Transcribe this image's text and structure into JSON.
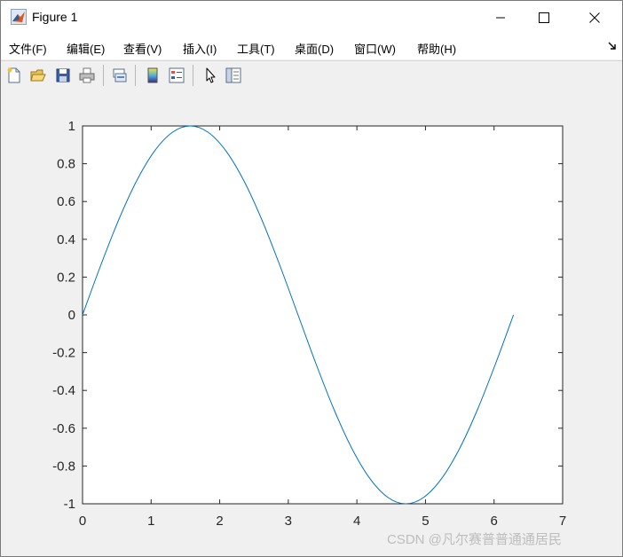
{
  "window": {
    "title": "Figure 1",
    "icon": "matlab-logo-icon"
  },
  "menu": {
    "items": [
      {
        "label": "文件(F)"
      },
      {
        "label": "编辑(E)"
      },
      {
        "label": "查看(V)"
      },
      {
        "label": "插入(I)"
      },
      {
        "label": "工具(T)"
      },
      {
        "label": "桌面(D)"
      },
      {
        "label": "窗口(W)"
      },
      {
        "label": "帮助(H)"
      }
    ]
  },
  "toolbar": {
    "buttons": [
      "new-figure-icon",
      "open-file-icon",
      "save-icon",
      "print-icon",
      "link-plot-icon",
      "insert-colorbar-icon",
      "insert-legend-icon",
      "edit-plot-arrow-icon",
      "property-inspector-icon"
    ]
  },
  "watermark": "CSDN @凡尔赛普普通通居民",
  "chart_data": {
    "type": "line",
    "title": "",
    "xlabel": "",
    "ylabel": "",
    "xlim": [
      0,
      7
    ],
    "ylim": [
      -1,
      1
    ],
    "xticks": [
      "0",
      "1",
      "2",
      "3",
      "4",
      "5",
      "6",
      "7"
    ],
    "yticks": [
      "-1",
      "-0.8",
      "-0.6",
      "-0.4",
      "-0.2",
      "0",
      "0.2",
      "0.4",
      "0.6",
      "0.8",
      "1"
    ],
    "grid": false,
    "series": [
      {
        "color": "#0072bd",
        "x": [
          0,
          0.2618,
          0.5236,
          0.7854,
          1.0472,
          1.309,
          1.5708,
          1.8326,
          2.0944,
          2.3562,
          2.618,
          2.8798,
          3.1416,
          3.4034,
          3.6652,
          3.927,
          4.1888,
          4.4506,
          4.7124,
          4.9742,
          5.236,
          5.4978,
          5.7596,
          6.0214,
          6.2832
        ],
        "y": [
          0,
          0.2588,
          0.5,
          0.7071,
          0.866,
          0.9659,
          1,
          0.9659,
          0.866,
          0.7071,
          0.5,
          0.2588,
          0,
          -0.2588,
          -0.5,
          -0.7071,
          -0.866,
          -0.9659,
          -1,
          -0.9659,
          -0.866,
          -0.7071,
          -0.5,
          -0.2588,
          0
        ]
      }
    ]
  }
}
